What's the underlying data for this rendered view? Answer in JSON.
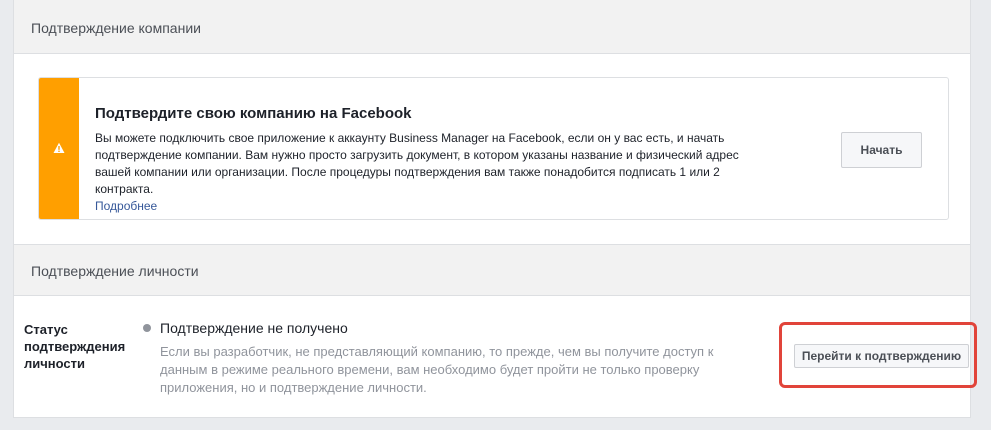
{
  "company_section": {
    "header": "Подтверждение компании",
    "card": {
      "icon": "warning-icon",
      "accent_color": "#ff9f00",
      "title": "Подтвердите свою компанию на Facebook",
      "body": "Вы можете подключить свое приложение к аккаунту Business Manager на Facebook, если он у вас есть, и начать подтверждение компании. Вам нужно просто загрузить документ, в котором указаны название и физический адрес вашей компании или организации. После процедуры подтверждения вам также понадобится подписать 1 или 2 контракта.",
      "learn_more": "Подробнее",
      "start_button": "Начать"
    }
  },
  "identity_section": {
    "header": "Подтверждение личности",
    "status_label": "Статус подтверждения личности",
    "status_value": "Подтверждение не получено",
    "status_description": "Если вы разработчик, не представляющий компанию, то прежде, чем вы получите доступ к данным в режиме реального времени, вам необходимо будет пройти не только проверку приложения, но и подтверждение личности.",
    "verify_button": "Перейти к подтверждению",
    "highlight_color": "#e1443a"
  }
}
